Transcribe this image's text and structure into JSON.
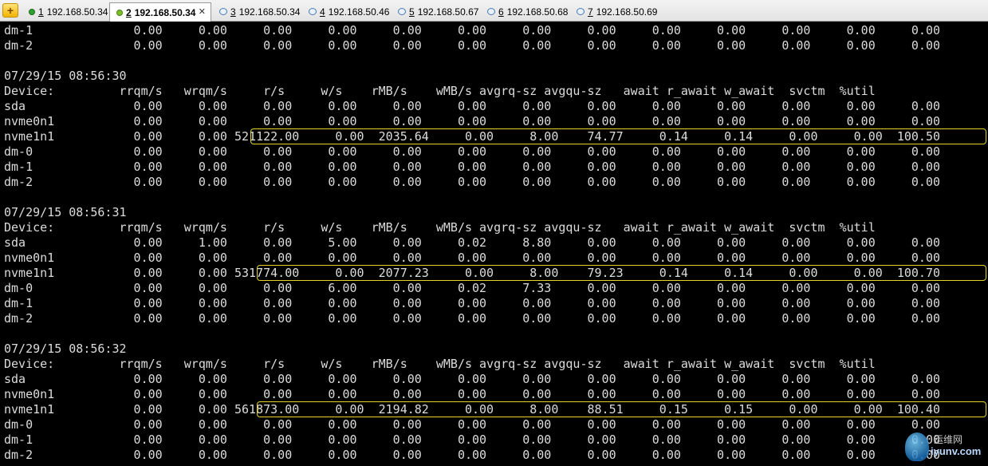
{
  "tabs": [
    {
      "num": "1",
      "label": "192.168.50.34",
      "icon": "status-dot-icon",
      "active": false
    },
    {
      "num": "2",
      "label": "192.168.50.34",
      "icon": "status-dot-icon",
      "active": true,
      "close": "✕"
    },
    {
      "num": "3",
      "label": "192.168.50.34",
      "icon": "chat-bubble-icon",
      "active": false
    },
    {
      "num": "4",
      "label": "192.168.50.46",
      "icon": "chat-bubble-icon",
      "active": false
    },
    {
      "num": "5",
      "label": "192.168.50.67",
      "icon": "chat-bubble-icon",
      "active": false
    },
    {
      "num": "6",
      "label": "192.168.50.68",
      "icon": "chat-bubble-icon",
      "active": false
    },
    {
      "num": "7",
      "label": "192.168.50.69",
      "icon": "chat-bubble-icon",
      "active": false
    }
  ],
  "add_tab_label": "+",
  "terminal": {
    "lines": [
      "dm-1              0.00     0.00     0.00     0.00     0.00     0.00     0.00     0.00     0.00     0.00     0.00     0.00     0.00",
      "dm-2              0.00     0.00     0.00     0.00     0.00     0.00     0.00     0.00     0.00     0.00     0.00     0.00     0.00",
      "",
      "07/29/15 08:56:30",
      "Device:         rrqm/s   wrqm/s     r/s     w/s    rMB/s    wMB/s avgrq-sz avgqu-sz   await r_await w_await  svctm  %util",
      "sda               0.00     0.00     0.00     0.00     0.00     0.00     0.00     0.00     0.00     0.00     0.00     0.00     0.00",
      "nvme0n1           0.00     0.00     0.00     0.00     0.00     0.00     0.00     0.00     0.00     0.00     0.00     0.00     0.00",
      "nvme1n1           0.00     0.00 521122.00     0.00  2035.64     0.00     8.00    74.77     0.14     0.14     0.00     0.00  100.50",
      "dm-0              0.00     0.00     0.00     0.00     0.00     0.00     0.00     0.00     0.00     0.00     0.00     0.00     0.00",
      "dm-1              0.00     0.00     0.00     0.00     0.00     0.00     0.00     0.00     0.00     0.00     0.00     0.00     0.00",
      "dm-2              0.00     0.00     0.00     0.00     0.00     0.00     0.00     0.00     0.00     0.00     0.00     0.00     0.00",
      "",
      "07/29/15 08:56:31",
      "Device:         rrqm/s   wrqm/s     r/s     w/s    rMB/s    wMB/s avgrq-sz avgqu-sz   await r_await w_await  svctm  %util",
      "sda               0.00     1.00     0.00     5.00     0.00     0.02     8.80     0.00     0.00     0.00     0.00     0.00     0.00",
      "nvme0n1           0.00     0.00     0.00     0.00     0.00     0.00     0.00     0.00     0.00     0.00     0.00     0.00     0.00",
      "nvme1n1           0.00     0.00 531774.00     0.00  2077.23     0.00     8.00    79.23     0.14     0.14     0.00     0.00  100.70",
      "dm-0              0.00     0.00     0.00     6.00     0.00     0.02     7.33     0.00     0.00     0.00     0.00     0.00     0.00",
      "dm-1              0.00     0.00     0.00     0.00     0.00     0.00     0.00     0.00     0.00     0.00     0.00     0.00     0.00",
      "dm-2              0.00     0.00     0.00     0.00     0.00     0.00     0.00     0.00     0.00     0.00     0.00     0.00     0.00",
      "",
      "07/29/15 08:56:32",
      "Device:         rrqm/s   wrqm/s     r/s     w/s    rMB/s    wMB/s avgrq-sz avgqu-sz   await r_await w_await  svctm  %util",
      "sda               0.00     0.00     0.00     0.00     0.00     0.00     0.00     0.00     0.00     0.00     0.00     0.00     0.00",
      "nvme0n1           0.00     0.00     0.00     0.00     0.00     0.00     0.00     0.00     0.00     0.00     0.00     0.00     0.00",
      "nvme1n1           0.00     0.00 561873.00     0.00  2194.82     0.00     8.00    88.51     0.15     0.15     0.00     0.00  100.40",
      "dm-0              0.00     0.00     0.00     0.00     0.00     0.00     0.00     0.00     0.00     0.00     0.00     0.00     0.00",
      "dm-1              0.00     0.00     0.00     0.00     0.00     0.00     0.00     0.00     0.00     0.00     0.00     0.00     0.00",
      "dm-2              0.00     0.00     0.00     0.00     0.00     0.00     0.00     0.00     0.00     0.00     0.00     0.00     0.00"
    ],
    "highlight_color": "#e5d32a",
    "text_color": "#dcdcdc",
    "background": "#000000"
  },
  "watermark": {
    "top": "运维网",
    "bottom": "iyunv.com"
  }
}
